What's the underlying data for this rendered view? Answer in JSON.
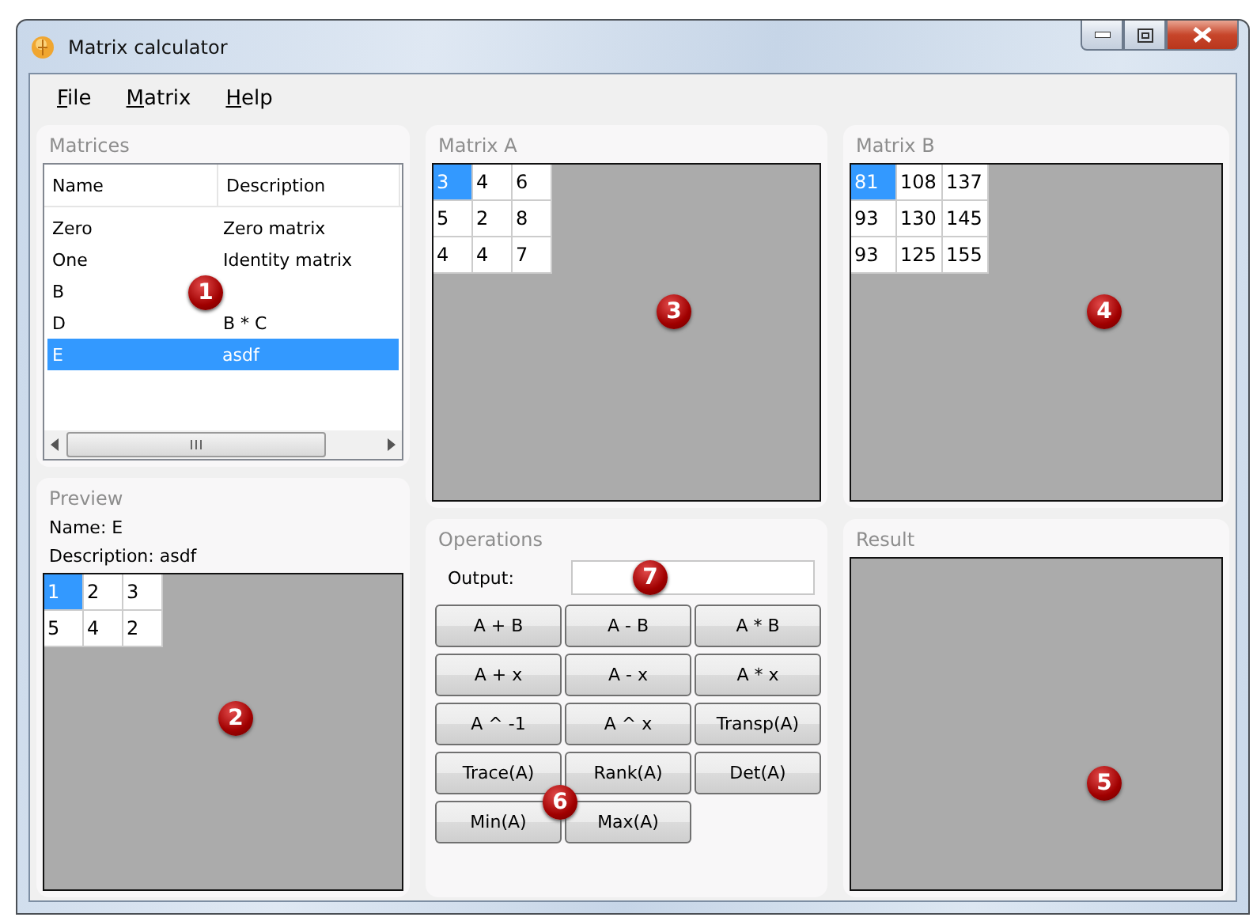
{
  "window": {
    "title": "Matrix calculator"
  },
  "menu": [
    {
      "label": "File"
    },
    {
      "label": "Matrix"
    },
    {
      "label": "Help"
    }
  ],
  "matrices": {
    "title": "Matrices",
    "columns": [
      "Name",
      "Description"
    ],
    "callout": "1",
    "rows": [
      {
        "name": "Zero",
        "description": "Zero matrix",
        "selected": false
      },
      {
        "name": "One",
        "description": "Identity matrix",
        "selected": false
      },
      {
        "name": "B",
        "description": "",
        "selected": false
      },
      {
        "name": "D",
        "description": "B * C",
        "selected": false
      },
      {
        "name": "E",
        "description": "asdf",
        "selected": true
      }
    ]
  },
  "preview": {
    "title": "Preview",
    "name_line": "Name: E",
    "description_line": "Description: asdf",
    "callout": "2",
    "grid": [
      [
        {
          "value": "1",
          "selected": true
        },
        {
          "value": "2",
          "selected": false
        },
        {
          "value": "3",
          "selected": false
        }
      ],
      [
        {
          "value": "5",
          "selected": false
        },
        {
          "value": "4",
          "selected": false
        },
        {
          "value": "2",
          "selected": false
        }
      ]
    ]
  },
  "matrix_a": {
    "title": "Matrix A",
    "callout": "3",
    "grid": [
      [
        {
          "value": "3",
          "selected": true
        },
        {
          "value": "4",
          "selected": false
        },
        {
          "value": "6",
          "selected": false
        }
      ],
      [
        {
          "value": "5",
          "selected": false
        },
        {
          "value": "2",
          "selected": false
        },
        {
          "value": "8",
          "selected": false
        }
      ],
      [
        {
          "value": "4",
          "selected": false
        },
        {
          "value": "4",
          "selected": false
        },
        {
          "value": "7",
          "selected": false
        }
      ]
    ]
  },
  "matrix_b": {
    "title": "Matrix B",
    "callout": "4",
    "grid": [
      [
        {
          "value": "81",
          "selected": true
        },
        {
          "value": "108",
          "selected": false
        },
        {
          "value": "137",
          "selected": false
        }
      ],
      [
        {
          "value": "93",
          "selected": false
        },
        {
          "value": "130",
          "selected": false
        },
        {
          "value": "145",
          "selected": false
        }
      ],
      [
        {
          "value": "93",
          "selected": false
        },
        {
          "value": "125",
          "selected": false
        },
        {
          "value": "155",
          "selected": false
        }
      ]
    ]
  },
  "operations": {
    "title": "Operations",
    "output_label": "Output:",
    "output_callout": "7",
    "callout": "6",
    "buttons": [
      "A + B",
      "A - B",
      "A * B",
      "A + x",
      "A - x",
      "A * x",
      "A ^ -1",
      "A ^ x",
      "Transp(A)",
      "Trace(A)",
      "Rank(A)",
      "Det(A)",
      "Min(A)",
      "Max(A)"
    ]
  },
  "result": {
    "title": "Result",
    "callout": "5"
  }
}
